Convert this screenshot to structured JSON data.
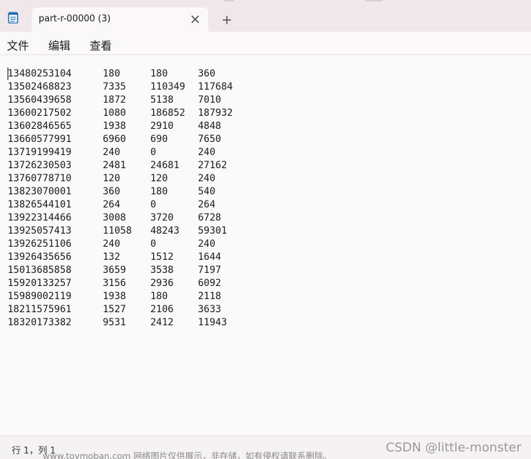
{
  "window": {
    "tab_title": "part-r-00000 (3)",
    "app_icon": "notepad-icon",
    "close_icon": "close-icon",
    "new_tab_icon": "plus-icon"
  },
  "menu": {
    "items": [
      "文件",
      "编辑",
      "查看"
    ]
  },
  "editor": {
    "rows": [
      [
        "13480253104",
        "180",
        "180",
        "360"
      ],
      [
        "13502468823",
        "7335",
        "110349",
        "117684"
      ],
      [
        "13560439658",
        "1872",
        "5138",
        "7010"
      ],
      [
        "13600217502",
        "1080",
        "186852",
        "187932"
      ],
      [
        "13602846565",
        "1938",
        "2910",
        "4848"
      ],
      [
        "13660577991",
        "6960",
        "690",
        "7650"
      ],
      [
        "13719199419",
        "240",
        "0",
        "240"
      ],
      [
        "13726230503",
        "2481",
        "24681",
        "27162"
      ],
      [
        "13760778710",
        "120",
        "120",
        "240"
      ],
      [
        "13823070001",
        "360",
        "180",
        "540"
      ],
      [
        "13826544101",
        "264",
        "0",
        "264"
      ],
      [
        "13922314466",
        "3008",
        "3720",
        "6728"
      ],
      [
        "13925057413",
        "11058",
        "48243",
        "59301"
      ],
      [
        "13926251106",
        "240",
        "0",
        "240"
      ],
      [
        "13926435656",
        "132",
        "1512",
        "1644"
      ],
      [
        "15013685858",
        "3659",
        "3538",
        "7197"
      ],
      [
        "15920133257",
        "3156",
        "2936",
        "6092"
      ],
      [
        "15989002119",
        "1938",
        "180",
        "2118"
      ],
      [
        "18211575961",
        "1527",
        "2106",
        "3633"
      ],
      [
        "18320173382",
        "9531",
        "2412",
        "11943"
      ]
    ]
  },
  "status": {
    "position": "行 1，列 1",
    "watermark_left": "www.toymoban.com 网络图片仅供展示，非存储，如有侵权请联系删除。",
    "watermark_right": "CSDN @little-monster"
  },
  "colors": {
    "titlebar_bg": "#f0e7ea",
    "tab_bg": "#faf8f8",
    "editor_bg": "#fafafa",
    "icon_blue": "#1f6fb8"
  }
}
